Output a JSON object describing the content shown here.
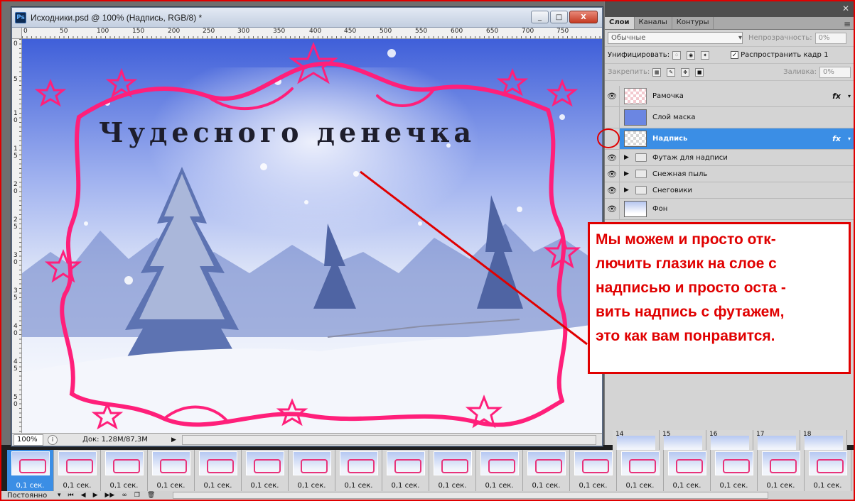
{
  "document": {
    "title": "Исходники.psd @ 100% (Надпись, RGB/8) *",
    "app_badge": "Ps",
    "window_buttons": [
      "_",
      "□",
      "X"
    ],
    "ruler_top": [
      "0",
      "50",
      "100",
      "150",
      "200",
      "250",
      "300",
      "350",
      "400",
      "450",
      "500",
      "550",
      "600",
      "650",
      "700",
      "750"
    ],
    "ruler_left": [
      "0",
      "5",
      "1 0",
      "1 5",
      "2 0",
      "2 5",
      "3 0",
      "3 5",
      "4 0",
      "4 5",
      "5 0"
    ],
    "canvas_text": "Чудесного денечка",
    "zoom": "100%",
    "doc_info": "Док: 1,28M/87,3M"
  },
  "layers_panel": {
    "tabs": [
      "Слои",
      "Каналы",
      "Контуры"
    ],
    "active_tab": "Слои",
    "blend_mode": "Обычные",
    "opacity_label": "Непрозрачность:",
    "opacity_value": "0%",
    "unify_label": "Унифицировать:",
    "propagate_label": "Распространить кадр 1",
    "propagate_checked": true,
    "lock_label": "Закрепить:",
    "fill_label": "Заливка:",
    "fill_value": "0%",
    "layers": [
      {
        "name": "Рамочка",
        "visible": true,
        "fx": "fx",
        "thumb": "pink",
        "type": "layer"
      },
      {
        "name": "Слой маска",
        "visible": false,
        "fx": "",
        "thumb": "blue",
        "type": "layer"
      },
      {
        "name": "Надпись",
        "visible": false,
        "fx": "fx",
        "thumb": "transparent",
        "type": "layer",
        "selected": true
      },
      {
        "name": "Футаж для надписи",
        "visible": true,
        "fx": "",
        "type": "group"
      },
      {
        "name": "Снежная пыль",
        "visible": true,
        "fx": "",
        "type": "group"
      },
      {
        "name": "Снеговики",
        "visible": true,
        "fx": "",
        "type": "group"
      },
      {
        "name": "Фон",
        "visible": true,
        "fx": "",
        "thumb": "photo",
        "type": "layer"
      }
    ]
  },
  "callout": {
    "lines": [
      "Мы можем и просто отк-",
      "лючить глазик на слое с",
      "надписью и просто оста -",
      "вить надпись с футажем,",
      "это как вам понравится."
    ]
  },
  "timeline": {
    "top_frames": [
      "14",
      "15",
      "16",
      "17",
      "18"
    ],
    "frame_delay": "0,1 сек.",
    "frame_count": 18,
    "loop": "Постоянно"
  },
  "colors": {
    "accent_red": "#e00000",
    "selection_blue": "#3b8ee5",
    "frame_pink": "#ff1f7a"
  }
}
